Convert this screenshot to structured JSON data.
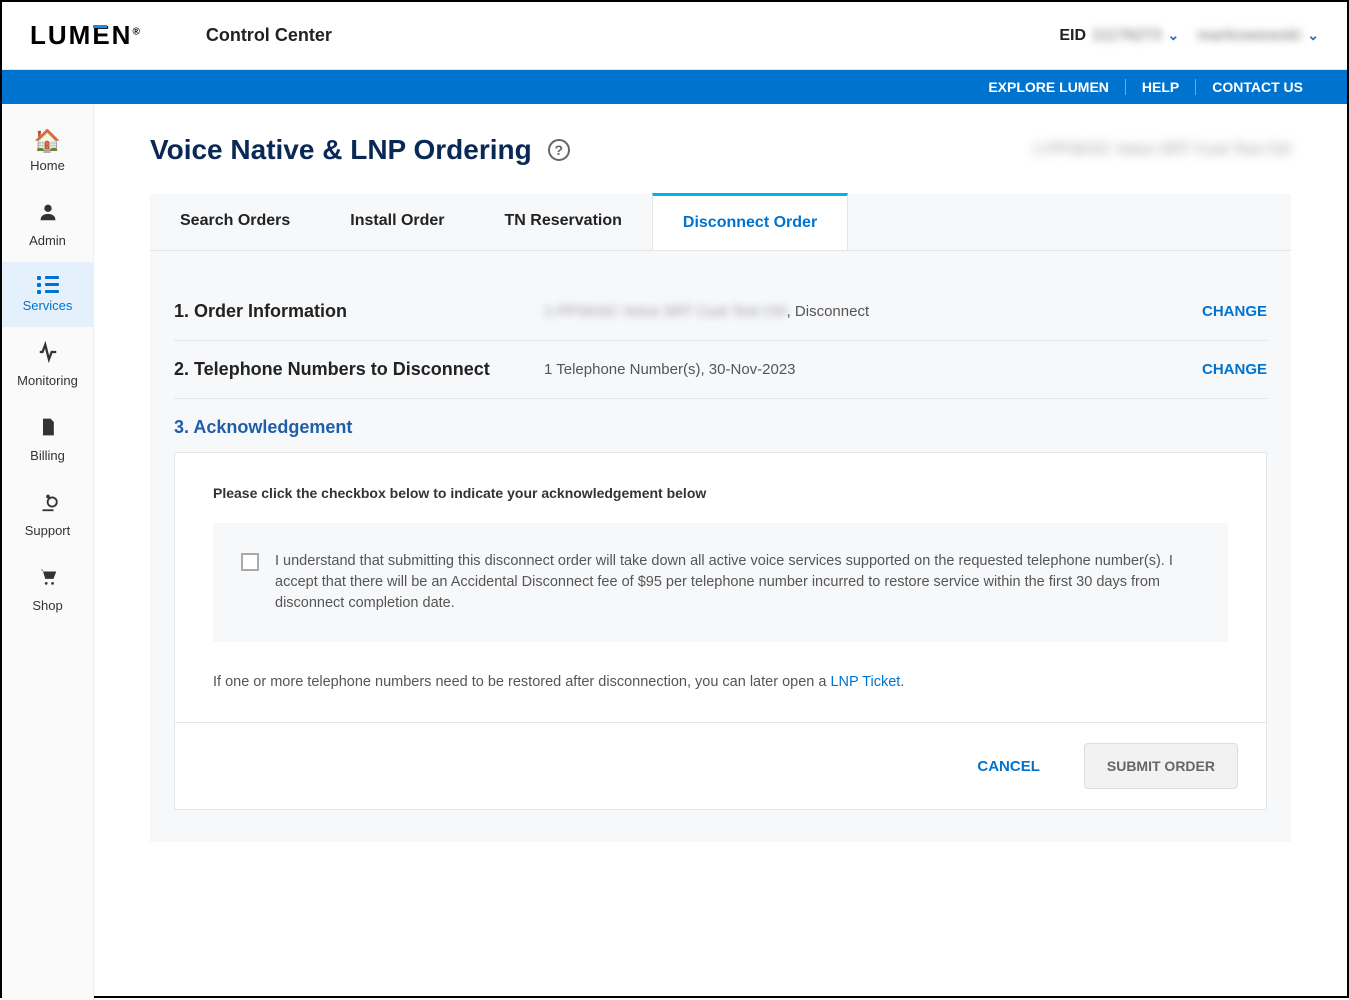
{
  "header": {
    "brand": "LUMEN",
    "subtitle": "Control Center",
    "eid_label": "EID",
    "eid_value": "11176273",
    "user_value": "markowewski"
  },
  "navbar": {
    "explore": "EXPLORE LUMEN",
    "help": "HELP",
    "contact": "CONTACT US"
  },
  "sidebar": {
    "items": [
      {
        "label": "Home",
        "icon": "🏠"
      },
      {
        "label": "Admin",
        "icon": "👤"
      },
      {
        "label": "Services",
        "icon": "list"
      },
      {
        "label": "Monitoring",
        "icon": "📈"
      },
      {
        "label": "Billing",
        "icon": "🧾"
      },
      {
        "label": "Support",
        "icon": "⚙️"
      },
      {
        "label": "Shop",
        "icon": "🛒"
      }
    ]
  },
  "page": {
    "title": "Voice Native & LNP Ordering",
    "customer": "1-PPSKSC Voice SRT Cust Test Ctrl"
  },
  "tabs": {
    "search": "Search Orders",
    "install": "Install Order",
    "tn": "TN Reservation",
    "disconnect": "Disconnect Order"
  },
  "steps": {
    "s1_title": "1. Order Information",
    "s1_summary_prefix": "1-PPSKSC Voice SRT Cust Test Ctrl",
    "s1_summary_suffix": ", Disconnect",
    "s2_title": "2. Telephone Numbers to Disconnect",
    "s2_summary": "1 Telephone Number(s), 30-Nov-2023",
    "s3_title": "3. Acknowledgement",
    "change": "CHANGE"
  },
  "ack": {
    "instruction": "Please click the checkbox below to indicate your acknowledgement below",
    "text": "I understand that submitting this disconnect order will take down all active voice services supported on the requested telephone number(s). I accept that there will be an Accidental Disconnect fee of $95 per telephone number incurred to restore service within the first 30 days from disconnect completion date.",
    "restore_prefix": "If one or more telephone numbers need to be restored after disconnection, you can later open a ",
    "restore_link": "LNP Ticket",
    "restore_suffix": "."
  },
  "buttons": {
    "cancel": "CANCEL",
    "submit": "SUBMIT ORDER"
  }
}
